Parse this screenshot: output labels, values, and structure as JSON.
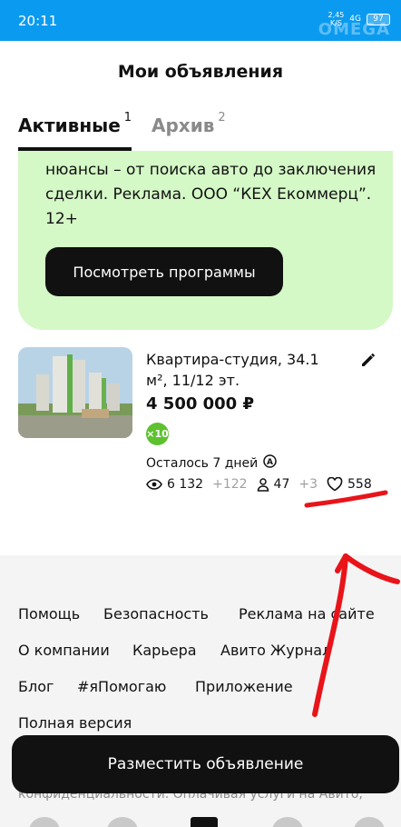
{
  "status_bar": {
    "time": "20:11",
    "speed": "2,45",
    "speed_unit": "K/S",
    "network": "4G",
    "battery": "97",
    "watermark": "OMEGA"
  },
  "page": {
    "title": "Мои объявления"
  },
  "tabs": [
    {
      "label": "Активные",
      "count": "1"
    },
    {
      "label": "Архив",
      "count": "2"
    }
  ],
  "promo": {
    "text": "нюансы – от поиска авто до заключения сделки. Реклама. ООО “КЕХ Екоммерц”. 12+",
    "button_label": "Посмотреть программы",
    "background": "#d4f8c6"
  },
  "listing": {
    "title": "Квартира-студия, 34.1 м², 11/12 эт.",
    "price": "4 500 000 ₽",
    "boost_badge": "×10",
    "days_left": "Осталось 7 дней",
    "stats": {
      "views": "6 132",
      "views_delta": "+122",
      "contacts": "47",
      "contacts_delta": "+3",
      "favorites": "558"
    },
    "icons": [
      "pencil-icon",
      "eye-icon",
      "person-icon",
      "heart-icon",
      "autorenew-icon"
    ]
  },
  "footer": {
    "links": [
      "Помощь",
      "Безопасность",
      "Реклама на сайте",
      "О компании",
      "Карьера",
      "Авито Журнал",
      "Блог",
      "#яПомогаю",
      "Приложение",
      "Полная версия"
    ],
    "legal_text": "конфиденциальности. Оплачивая услуги на Авито,"
  },
  "cta": {
    "label": "Разместить объявление"
  },
  "colors": {
    "status_bar": "#0a9bf0",
    "accent_green": "#5ec12f",
    "annotation": "#e8141a"
  }
}
